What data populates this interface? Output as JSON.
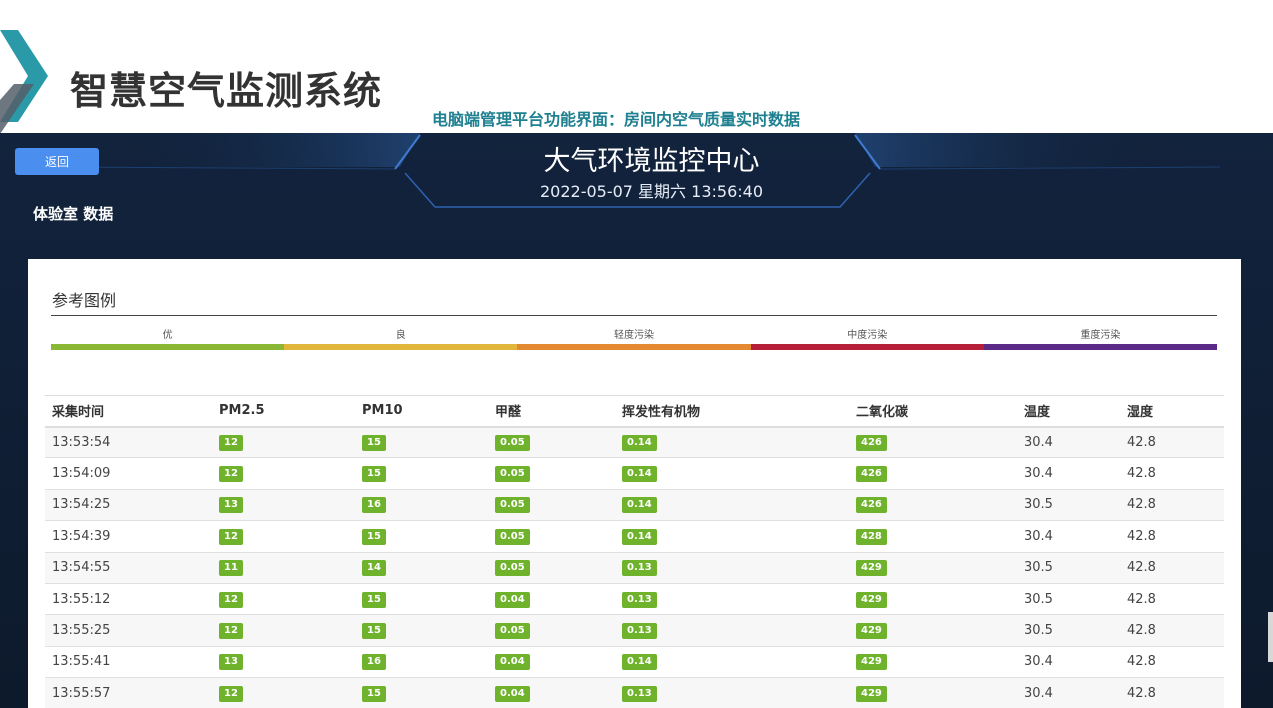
{
  "slide": {
    "title": "智慧空气监测系统",
    "subtitle": "电脑端管理平台功能界面：房间内空气质量实时数据"
  },
  "dashboard": {
    "back_label": "返回",
    "room_title": "体验室 数据",
    "center_title": "大气环境监控中心",
    "datetime": "2022-05-07 星期六 13:56:40",
    "legend_title": "参考图例",
    "legend": [
      {
        "label": "优",
        "color": "#8ab835"
      },
      {
        "label": "良",
        "color": "#e2b63a"
      },
      {
        "label": "轻度污染",
        "color": "#e38a31"
      },
      {
        "label": "中度污染",
        "color": "#b51f37"
      },
      {
        "label": "重度污染",
        "color": "#5b2a86"
      }
    ],
    "badge_color": "#6fb22c",
    "columns": [
      "采集时间",
      "PM2.5",
      "PM10",
      "甲醛",
      "挥发性有机物",
      "二氧化碳",
      "温度",
      "湿度"
    ],
    "rows": [
      [
        "13:53:54",
        "12",
        "15",
        "0.05",
        "0.14",
        "426",
        "30.4",
        "42.8"
      ],
      [
        "13:54:09",
        "12",
        "15",
        "0.05",
        "0.14",
        "426",
        "30.4",
        "42.8"
      ],
      [
        "13:54:25",
        "13",
        "16",
        "0.05",
        "0.14",
        "426",
        "30.5",
        "42.8"
      ],
      [
        "13:54:39",
        "12",
        "15",
        "0.05",
        "0.14",
        "428",
        "30.4",
        "42.8"
      ],
      [
        "13:54:55",
        "11",
        "14",
        "0.05",
        "0.13",
        "429",
        "30.5",
        "42.8"
      ],
      [
        "13:55:12",
        "12",
        "15",
        "0.04",
        "0.13",
        "429",
        "30.5",
        "42.8"
      ],
      [
        "13:55:25",
        "12",
        "15",
        "0.05",
        "0.13",
        "429",
        "30.5",
        "42.8"
      ],
      [
        "13:55:41",
        "13",
        "16",
        "0.04",
        "0.14",
        "429",
        "30.4",
        "42.8"
      ],
      [
        "13:55:57",
        "12",
        "15",
        "0.04",
        "0.13",
        "429",
        "30.4",
        "42.8"
      ]
    ]
  }
}
